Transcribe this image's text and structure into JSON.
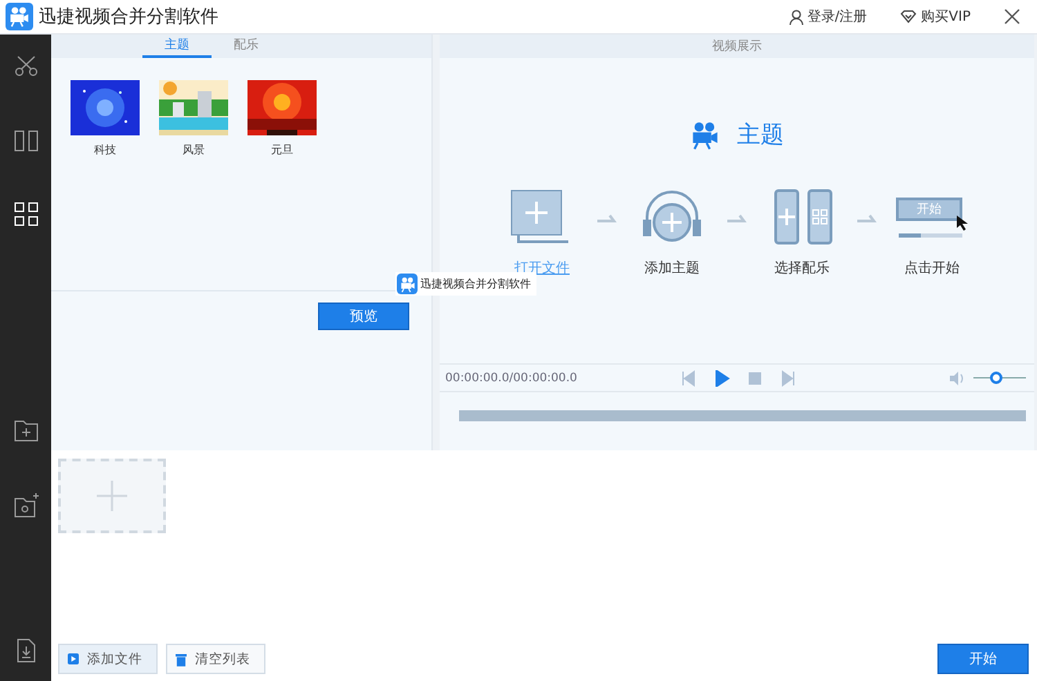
{
  "window": {
    "title": "迅捷视频合并分割软件",
    "links": [
      {
        "kind": "user",
        "label": "登录/注册"
      },
      {
        "kind": "vip",
        "label": "购买VIP"
      }
    ]
  },
  "sidebar": {
    "items": [
      {
        "kind": "cut",
        "selected": false
      },
      {
        "kind": "split",
        "selected": false
      },
      {
        "kind": "grid",
        "selected": true
      },
      {
        "kind": "folder-add",
        "selected": false
      },
      {
        "kind": "folder-settings",
        "selected": false
      },
      {
        "kind": "download",
        "selected": false
      }
    ]
  },
  "left_panel": {
    "tabs": [
      {
        "label": "主题",
        "selected": true
      },
      {
        "label": "配乐",
        "selected": false
      }
    ],
    "themes": [
      {
        "label": "科技",
        "kind": "tech"
      },
      {
        "label": "风景",
        "kind": "scenery"
      },
      {
        "label": "元旦",
        "kind": "festival"
      }
    ],
    "preview_button": "预览"
  },
  "drag_label": "迅捷视频合并分割软件",
  "preview": {
    "header": "视频展示",
    "title": "主题",
    "steps": [
      {
        "kind": "open",
        "label": "打开文件",
        "highlighted": true
      },
      {
        "kind": "theme",
        "label": "添加主题",
        "highlighted": false
      },
      {
        "kind": "music",
        "label": "选择配乐",
        "highlighted": false
      },
      {
        "kind": "start",
        "label": "点击开始",
        "highlighted": false,
        "button": "开始"
      }
    ],
    "time": "00:00:00.0/00:00:00.0",
    "controls": [
      {
        "kind": "prev",
        "disabled": true
      },
      {
        "kind": "play",
        "disabled": false
      },
      {
        "kind": "stop",
        "disabled": true
      },
      {
        "kind": "next",
        "disabled": true
      }
    ],
    "volume": {
      "level": 0.45
    }
  },
  "bottom": {
    "add_file": "添加文件",
    "clear_list": "清空列表",
    "start": "开始"
  }
}
